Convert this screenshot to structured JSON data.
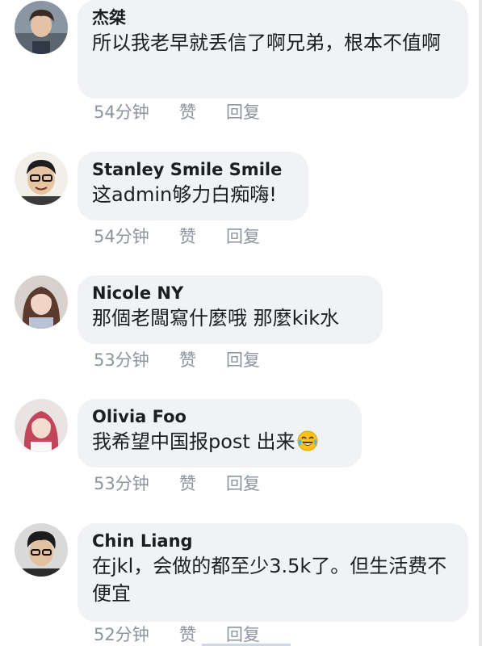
{
  "comments": [
    {
      "author": "杰桀",
      "text": "所以我老早就丢信了啊兄弟，根本不值啊",
      "time": "54分钟",
      "like": "赞",
      "reply": "回复",
      "avatar_icon": "avatar-photo"
    },
    {
      "author": "Stanley Smile Smile",
      "text": "这admin够力白痴嗨!",
      "time": "54分钟",
      "like": "赞",
      "reply": "回复",
      "avatar_icon": "avatar-photo"
    },
    {
      "author": "Nicole NY",
      "text": "那個老闆寫什麼哦 那麼kik水",
      "time": "53分钟",
      "like": "赞",
      "reply": "回复",
      "avatar_icon": "avatar-photo"
    },
    {
      "author": "Olivia Foo",
      "text": "我希望中国报post 出来",
      "emoji": "tears-of-joy-emoji",
      "time": "53分钟",
      "like": "赞",
      "reply": "回复",
      "avatar_icon": "avatar-photo"
    },
    {
      "author": "Chin Liang",
      "text": "在jkl，会做的都至少3.5k了。但生活费不便宜",
      "time": "52分钟",
      "like": "赞",
      "reply": "回复",
      "avatar_icon": "avatar-photo"
    }
  ],
  "colors": {
    "bubble": "#f0f2f5",
    "meta": "#8d949e",
    "text": "#1c1e21"
  }
}
